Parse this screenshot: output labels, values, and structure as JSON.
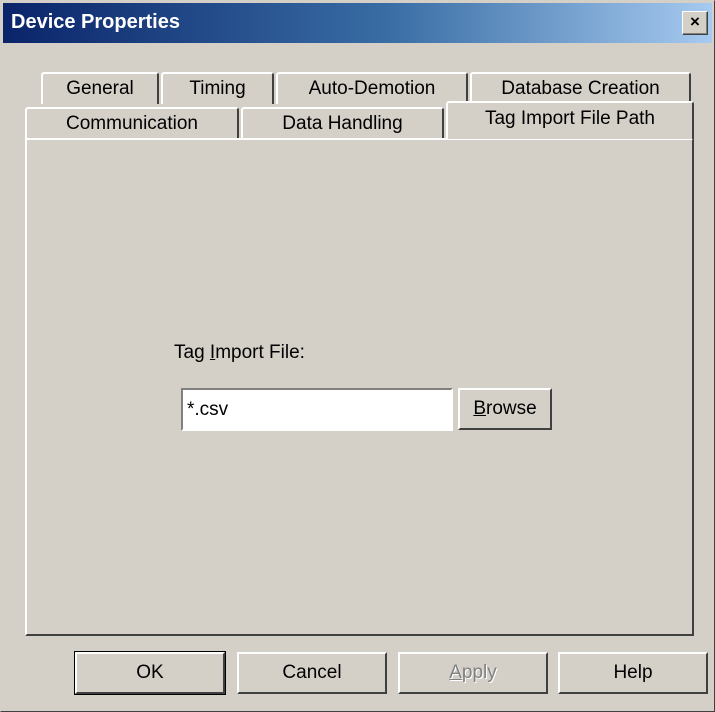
{
  "window": {
    "title": "Device Properties",
    "close_glyph": "×",
    "close_icon": "close-icon"
  },
  "tabs": {
    "row_back": [
      {
        "label": "General"
      },
      {
        "label": "Timing"
      },
      {
        "label": "Auto-Demotion"
      },
      {
        "label": "Database Creation"
      }
    ],
    "row_front": [
      {
        "label": "Communication"
      },
      {
        "label": "Data Handling"
      },
      {
        "label": "Tag Import File Path",
        "active": true
      }
    ]
  },
  "panel": {
    "label_before": "Tag ",
    "label_accel": "I",
    "label_after": "mport File:",
    "input_value": "*.csv",
    "browse_accel": "B",
    "browse_rest": "rowse"
  },
  "footer": {
    "ok_label": "OK",
    "cancel_label": "Cancel",
    "apply_accel": "A",
    "apply_rest": "pply",
    "help_label": "Help"
  }
}
